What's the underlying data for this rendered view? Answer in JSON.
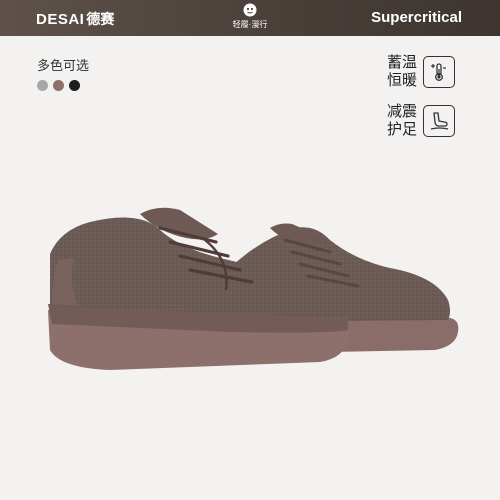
{
  "header": {
    "brand_latin": "DESAI",
    "brand_cjk": "德赛",
    "badge_text": "轻履·漫行",
    "badge_icon": "mascot-icon",
    "tech_name": "Supercritical"
  },
  "colors": {
    "label": "多色可选",
    "swatches": [
      "#a7a7a7",
      "#8d706c",
      "#1d1d1d"
    ],
    "header_bar": "#4f443d",
    "page_background": "#f3f2f1",
    "shoe_upper": "#6a5853",
    "shoe_sole": "#8d706c"
  },
  "features": [
    {
      "line1": "蓄温",
      "line2": "恒暖",
      "icon": "thermometer-icon"
    },
    {
      "line1": "减震",
      "line2": "护足",
      "icon": "foot-cushion-icon"
    }
  ],
  "product": {
    "icon": "sneaker-pair-image"
  }
}
